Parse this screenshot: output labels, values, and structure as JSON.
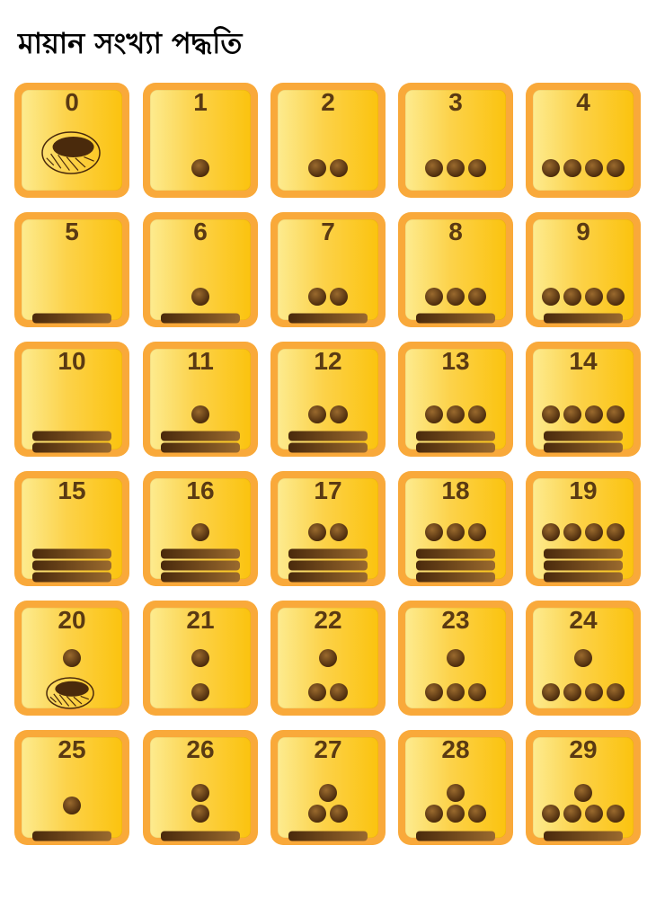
{
  "title": "মায়ান সংখ্যা পদ্ধতি",
  "colors": {
    "tile_border": "#f9a93a",
    "tile_gradient_light": "#fdeb8f",
    "tile_gradient_dark": "#fbc30f",
    "glyph_dark": "#4a2a0c",
    "glyph_light": "#9a6a2e",
    "number_text": "#5a3a13"
  },
  "numerals": [
    {
      "label": "0",
      "zeros": 1,
      "dots": 0,
      "bars": 0
    },
    {
      "label": "1",
      "zeros": 0,
      "dots": 1,
      "bars": 0
    },
    {
      "label": "2",
      "zeros": 0,
      "dots": 2,
      "bars": 0
    },
    {
      "label": "3",
      "zeros": 0,
      "dots": 3,
      "bars": 0
    },
    {
      "label": "4",
      "zeros": 0,
      "dots": 4,
      "bars": 0
    },
    {
      "label": "5",
      "zeros": 0,
      "dots": 0,
      "bars": 1
    },
    {
      "label": "6",
      "zeros": 0,
      "dots": 1,
      "bars": 1
    },
    {
      "label": "7",
      "zeros": 0,
      "dots": 2,
      "bars": 1
    },
    {
      "label": "8",
      "zeros": 0,
      "dots": 3,
      "bars": 1
    },
    {
      "label": "9",
      "zeros": 0,
      "dots": 4,
      "bars": 1
    },
    {
      "label": "10",
      "zeros": 0,
      "dots": 0,
      "bars": 2
    },
    {
      "label": "11",
      "zeros": 0,
      "dots": 1,
      "bars": 2
    },
    {
      "label": "12",
      "zeros": 0,
      "dots": 2,
      "bars": 2
    },
    {
      "label": "13",
      "zeros": 0,
      "dots": 3,
      "bars": 2
    },
    {
      "label": "14",
      "zeros": 0,
      "dots": 4,
      "bars": 2
    },
    {
      "label": "15",
      "zeros": 0,
      "dots": 0,
      "bars": 3
    },
    {
      "label": "16",
      "zeros": 0,
      "dots": 1,
      "bars": 3
    },
    {
      "label": "17",
      "zeros": 0,
      "dots": 2,
      "bars": 3
    },
    {
      "label": "18",
      "zeros": 0,
      "dots": 3,
      "bars": 3
    },
    {
      "label": "19",
      "zeros": 0,
      "dots": 4,
      "bars": 3
    },
    {
      "label": "20",
      "upper_dots": 1,
      "lower": "zero"
    },
    {
      "label": "21",
      "upper_dots": 1,
      "lower": "dots",
      "lower_dots": 1
    },
    {
      "label": "22",
      "upper_dots": 1,
      "lower": "dots",
      "lower_dots": 2
    },
    {
      "label": "23",
      "upper_dots": 1,
      "lower": "dots",
      "lower_dots": 3
    },
    {
      "label": "24",
      "upper_dots": 1,
      "lower": "dots",
      "lower_dots": 4
    },
    {
      "label": "25",
      "upper_dots": 1,
      "lower": "bar",
      "lower_dots": 0
    },
    {
      "label": "26",
      "upper_dots": 1,
      "lower": "bar",
      "lower_dots": 1
    },
    {
      "label": "27",
      "upper_dots": 1,
      "lower": "bar",
      "lower_dots": 2
    },
    {
      "label": "28",
      "upper_dots": 1,
      "lower": "bar",
      "lower_dots": 3
    },
    {
      "label": "29",
      "upper_dots": 1,
      "lower": "bar",
      "lower_dots": 4
    }
  ]
}
